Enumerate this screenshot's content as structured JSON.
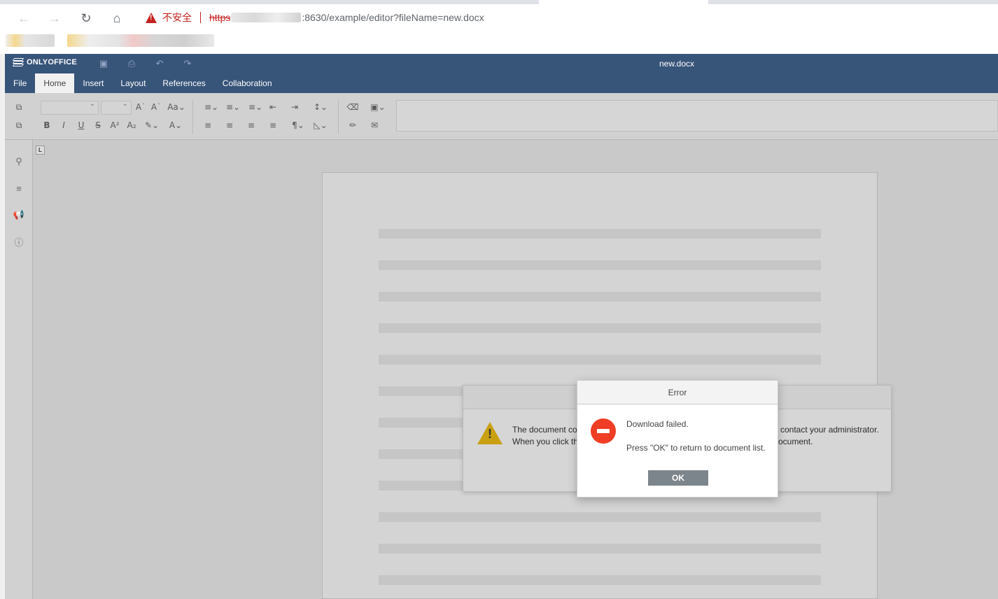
{
  "browser": {
    "insecure_label": "不安全",
    "url_scheme": "https",
    "url_rest": ":8630/example/editor?fileName=new.docx"
  },
  "editor": {
    "brand": "ONLYOFFICE",
    "doc_title": "new.docx",
    "menu": [
      {
        "label": "File"
      },
      {
        "label": "Home"
      },
      {
        "label": "Insert"
      },
      {
        "label": "Layout"
      },
      {
        "label": "References"
      },
      {
        "label": "Collaboration"
      }
    ],
    "active_tab": "Home"
  },
  "background_dialog": {
    "line1_left": "The document co",
    "line1_right": "contact your administrator.",
    "line2_left": "When you click th",
    "line2_right": "ocument."
  },
  "error_dialog": {
    "title": "Error",
    "message1": "Download failed.",
    "message2": "Press \"OK\" to return to document list.",
    "ok_label": "OK"
  },
  "colors": {
    "header_blue": "#375479",
    "error_red": "#f03d25",
    "warning_yellow": "#c9a012",
    "insecure_red": "#c5221f"
  }
}
